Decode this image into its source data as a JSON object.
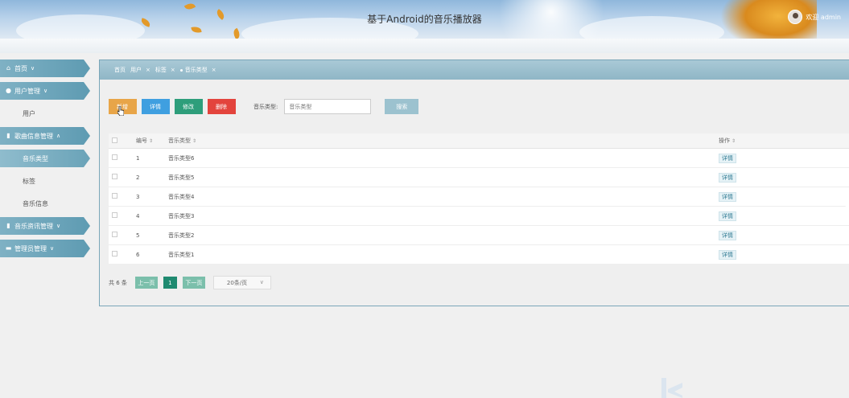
{
  "header": {
    "title": "基于Android的音乐播放器",
    "welcome": "欢迎 admin"
  },
  "sidebar": {
    "items": [
      {
        "label": "首页",
        "type": "group",
        "icon": "home-icon"
      },
      {
        "label": "用户管理",
        "type": "group",
        "icon": "user-icon"
      },
      {
        "label": "用户",
        "type": "sub"
      },
      {
        "label": "歌曲信息管理",
        "type": "group",
        "icon": "book-icon"
      },
      {
        "label": "音乐类型",
        "type": "sub",
        "active": true
      },
      {
        "label": "标签",
        "type": "sub"
      },
      {
        "label": "音乐信息",
        "type": "sub"
      },
      {
        "label": "音乐资讯管理",
        "type": "group",
        "icon": "book-icon"
      },
      {
        "label": "管理员管理",
        "type": "group",
        "icon": "keyboard-icon"
      }
    ]
  },
  "tabs": [
    {
      "label": "首页",
      "closable": false
    },
    {
      "label": "用户",
      "closable": true
    },
    {
      "label": "标签",
      "closable": true
    },
    {
      "label": "音乐类型",
      "closable": true,
      "active": true
    }
  ],
  "toolbar": {
    "add": "新增",
    "detail": "详情",
    "edit": "修改",
    "delete": "删除",
    "filter_label": "音乐类型:",
    "filter_placeholder": "音乐类型",
    "search": "搜索"
  },
  "table": {
    "columns": {
      "no": "编号",
      "type": "音乐类型",
      "op": "操作"
    },
    "rows": [
      {
        "no": "1",
        "type": "音乐类型6",
        "op": "详情"
      },
      {
        "no": "2",
        "type": "音乐类型5",
        "op": "详情"
      },
      {
        "no": "3",
        "type": "音乐类型4",
        "op": "详情"
      },
      {
        "no": "4",
        "type": "音乐类型3",
        "op": "详情"
      },
      {
        "no": "5",
        "type": "音乐类型2",
        "op": "详情"
      },
      {
        "no": "6",
        "type": "音乐类型1",
        "op": "详情"
      }
    ]
  },
  "pager": {
    "total": "共 6 条",
    "prev": "上一页",
    "current": "1",
    "next": "下一页",
    "page_size": "20条/页"
  },
  "colors": {
    "add": "#e8a548",
    "detail": "#3f9fe0",
    "edit": "#2e9e7b",
    "delete": "#e3443d",
    "accent": "#6aa3b8"
  }
}
